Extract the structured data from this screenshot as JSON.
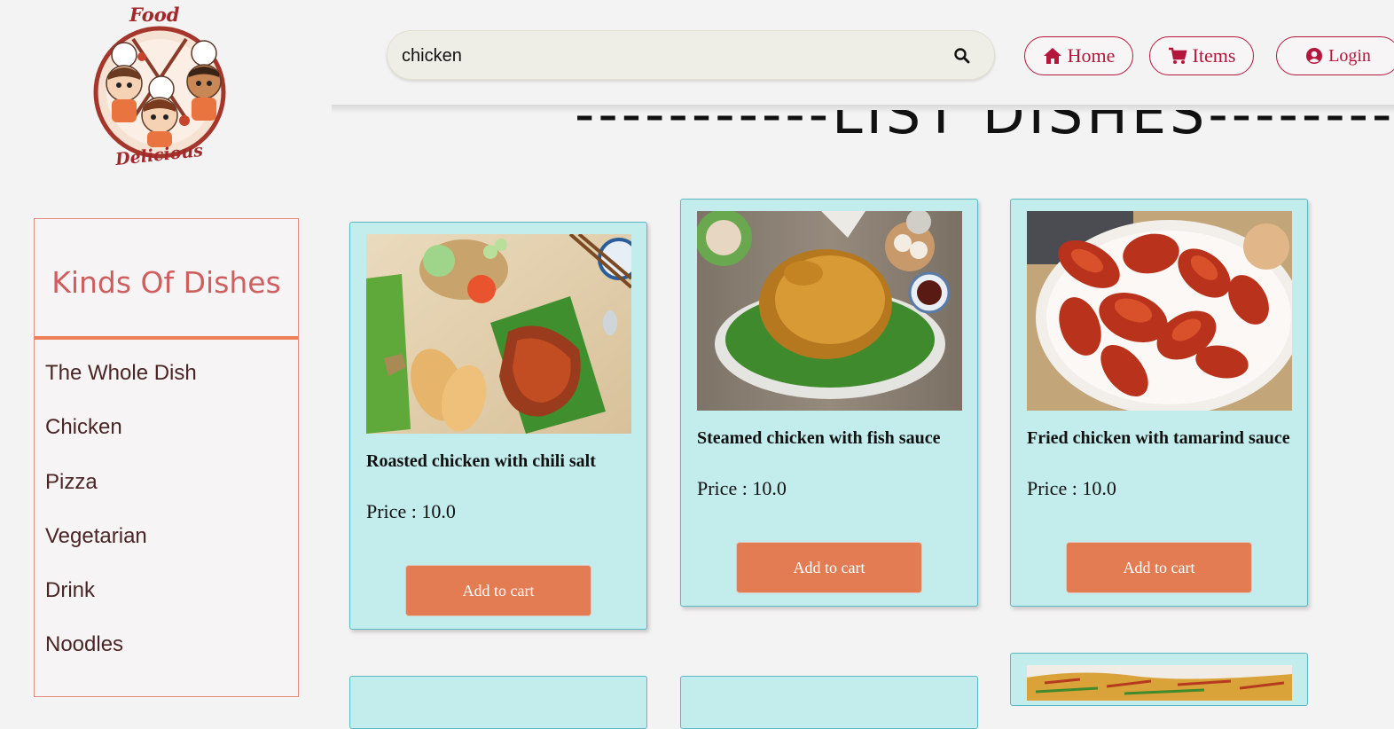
{
  "brand": {
    "logo_top_text": "Food",
    "logo_bottom_text": "Delicious"
  },
  "search": {
    "value": "chicken",
    "icon": "search-icon"
  },
  "nav": {
    "home": "Home",
    "items": "Items",
    "login": "Login",
    "home_icon": "home-icon",
    "items_icon": "cart-icon",
    "login_icon": "user-circle-icon"
  },
  "section_title": "-----------LIST DISHES-----------",
  "sidebar": {
    "title": "Kinds Of Dishes",
    "items": [
      {
        "label": "The Whole Dish"
      },
      {
        "label": "Chicken"
      },
      {
        "label": "Pizza"
      },
      {
        "label": "Vegetarian"
      },
      {
        "label": "Drink"
      },
      {
        "label": "Noodles"
      }
    ]
  },
  "dishes": [
    {
      "name": "Roasted chicken with chili salt",
      "price": "Price : 10.0",
      "button": "Add to cart"
    },
    {
      "name": "Steamed chicken with fish sauce",
      "price": "Price : 10.0",
      "button": "Add to cart"
    },
    {
      "name": "Fried chicken with tamarind sauce",
      "price": "Price : 10.0",
      "button": "Add to cart"
    }
  ],
  "colors": {
    "accent": "#b5173c",
    "card_bg": "#c3ecec",
    "button": "#e37b53",
    "sidebar_title": "#cf5f5f",
    "sidebar_rule": "#ee7e55"
  }
}
